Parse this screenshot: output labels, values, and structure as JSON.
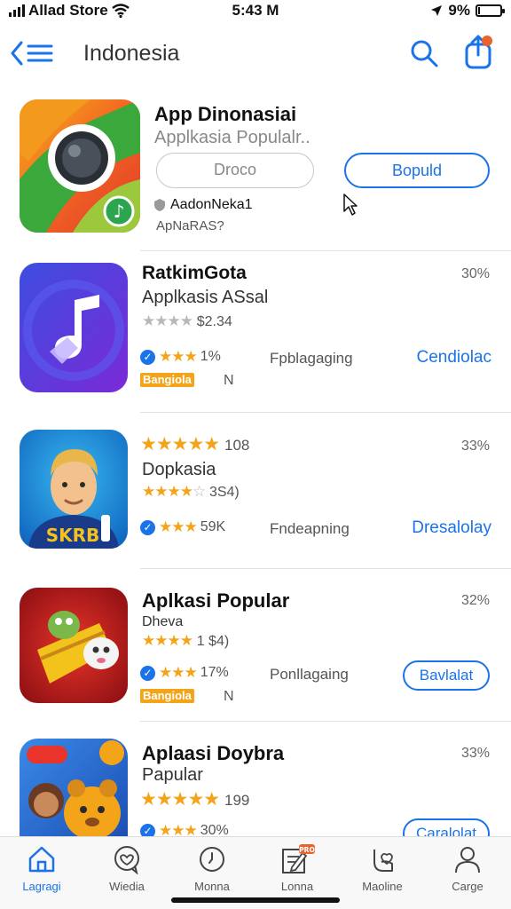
{
  "status_bar": {
    "carrier": "Allad Store",
    "time": "5:43 M",
    "battery": "9%"
  },
  "nav": {
    "title": "Indonesia",
    "back_icon": "back-list-icon",
    "search_icon": "search-icon",
    "share_icon": "share-icon"
  },
  "featured": {
    "name": "App Dinonasiai",
    "subtitle": "Applkasia Populalr..",
    "secondary_button": "Droco",
    "primary_button": "Bopuld",
    "developer": "AadonNeka1",
    "meta": "ApNaRAS?"
  },
  "apps": [
    {
      "name": "RatkimGota",
      "subtitle": "Applkasis ASsal",
      "percent": "30%",
      "rating_text": "$2.34",
      "count": "1%",
      "category": "Fpblagaging",
      "action": "Cendiolac",
      "badge": "Bangiola",
      "badge_extra": "N"
    },
    {
      "name": "",
      "rating_line": "108",
      "subtitle": "Dopkasia",
      "percent": "33%",
      "rating_text": "3S4)",
      "count": "59K",
      "category": "Fndeapning",
      "action": "Dresalolay"
    },
    {
      "name": "Aplkasi Popular",
      "subtitle": "Dheva",
      "percent": "32%",
      "rating_text": "1 $4)",
      "count": "17%",
      "category": "Ponllagaing",
      "action": "Bavlalat",
      "badge": "Bangiola",
      "badge_extra": "N"
    },
    {
      "name": "Aplaasi Doybra",
      "subtitle": "Papular",
      "percent": "33%",
      "rating_line": "199",
      "count": "30%",
      "action": "Caralolat"
    }
  ],
  "tabs": [
    {
      "label": "Lagragi",
      "icon": "home-icon"
    },
    {
      "label": "Wiedia",
      "icon": "heart-chat-icon"
    },
    {
      "label": "Monna",
      "icon": "clock-icon"
    },
    {
      "label": "Lonna",
      "icon": "edit-icon",
      "badge": "PRO"
    },
    {
      "label": "Maoline",
      "icon": "heart-hand-icon"
    },
    {
      "label": "Carge",
      "icon": "profile-icon"
    }
  ],
  "colors": {
    "accent": "#1a73e8",
    "star": "#f3a419",
    "badge_orange": "#e8642c"
  }
}
